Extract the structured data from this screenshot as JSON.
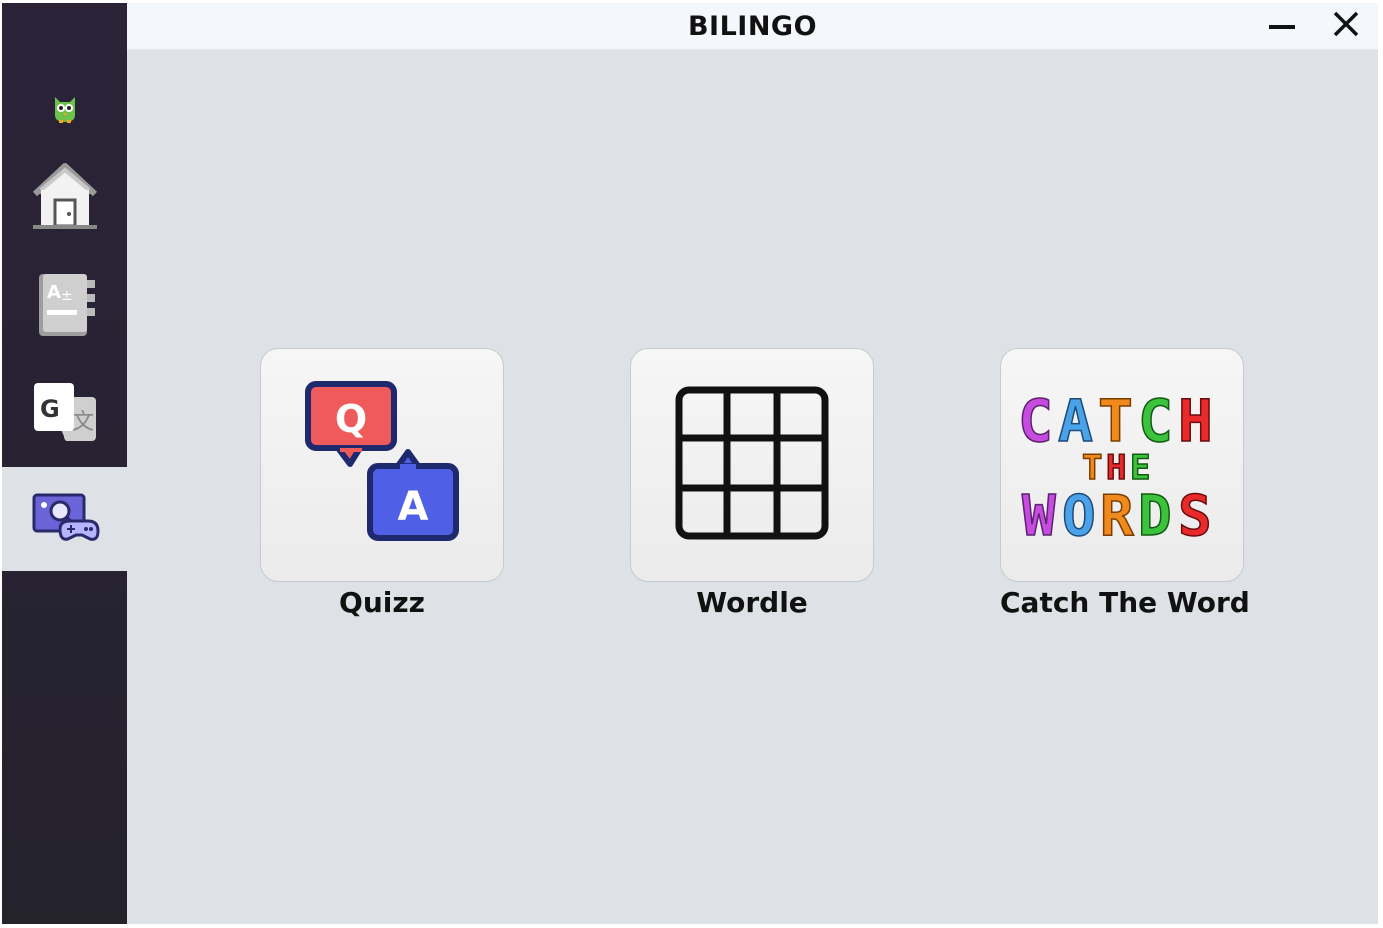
{
  "app": {
    "title": "BILINGO"
  },
  "window_controls": {
    "minimize_icon": "minimize-icon",
    "close_icon": "close-icon"
  },
  "sidebar": {
    "items": [
      {
        "icon": "owl-logo-icon",
        "active": false
      },
      {
        "icon": "home-icon",
        "active": false
      },
      {
        "icon": "dictionary-icon",
        "active": false
      },
      {
        "icon": "translate-icon",
        "active": false
      },
      {
        "icon": "games-icon",
        "active": true
      }
    ]
  },
  "games": [
    {
      "label": "Quizz",
      "icon": "quiz-icon"
    },
    {
      "label": "Wordle",
      "icon": "grid-icon"
    },
    {
      "label": "Catch The Word",
      "icon": "catch-the-words-logo"
    }
  ],
  "catch_logo": {
    "line1": "CATCH",
    "line2": "THE",
    "line3": "WORDS"
  },
  "colors": {
    "sidebar_bg": "#2b2338",
    "content_bg": "#dee1e6",
    "titlebar_bg": "#f4f7fb",
    "quiz_q": "#ef5b5b",
    "quiz_a": "#4f5fe6",
    "quiz_outline": "#1f2a6e"
  }
}
